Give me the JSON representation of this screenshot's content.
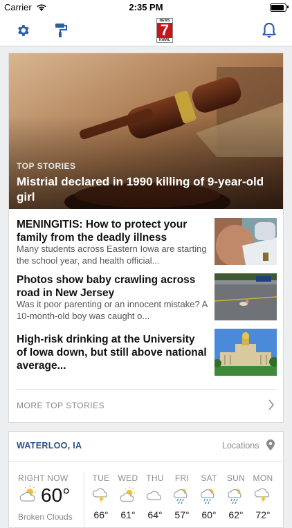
{
  "status_bar": {
    "carrier": "Carrier",
    "time": "2:35 PM"
  },
  "logo": {
    "top": "NEWS",
    "number": "7",
    "bottom": "KWWL"
  },
  "top_stories": {
    "hero": {
      "kicker": "TOP STORIES",
      "title": "Mistrial declared in 1990 killing of 9-year-old girl"
    },
    "stories": [
      {
        "title": "MENINGITIS: How to protect your family from the deadly illness",
        "summary": "Many students across Eastern Iowa are starting the school year, and health official..."
      },
      {
        "title": "Photos show baby crawling across road in New Jersey",
        "summary": "Was it poor parenting or an innocent mistake? A 10-month-old boy was caught o..."
      },
      {
        "title": "High-risk drinking at the University of Iowa down, but still above national average...",
        "summary": ""
      }
    ],
    "more_label": "MORE TOP STORIES"
  },
  "weather": {
    "city": "WATERLOO, IA",
    "locations_label": "Locations",
    "now": {
      "label": "RIGHT NOW",
      "temp": "60°",
      "condition": "Broken Clouds",
      "icon": "partly-cloudy-icon"
    },
    "forecast": [
      {
        "day": "TUE",
        "temp": "66°",
        "icon": "thunderstorm-icon"
      },
      {
        "day": "WED",
        "temp": "61°",
        "icon": "partly-cloudy-icon"
      },
      {
        "day": "THU",
        "temp": "64°",
        "icon": "cloud-icon"
      },
      {
        "day": "FRI",
        "temp": "57°",
        "icon": "rain-sun-icon"
      },
      {
        "day": "SAT",
        "temp": "60°",
        "icon": "rain-sun-icon"
      },
      {
        "day": "SUN",
        "temp": "62°",
        "icon": "rain-sun-icon"
      },
      {
        "day": "MON",
        "temp": "72°",
        "icon": "thunderstorm-icon"
      }
    ]
  },
  "colors": {
    "accent": "#2a5fa8",
    "city": "#2a4f8a",
    "logo_red": "#c7151b"
  }
}
